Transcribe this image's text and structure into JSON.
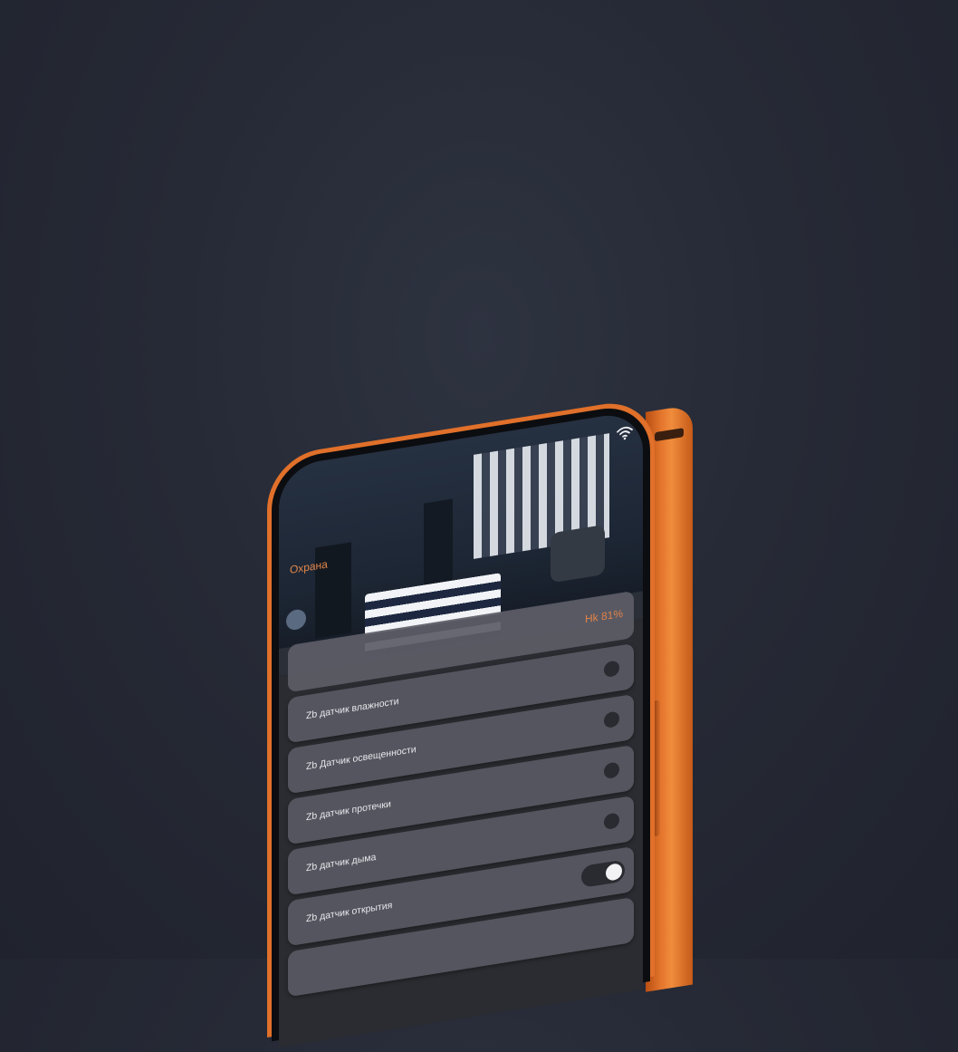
{
  "screen": {
    "title": "Охрана",
    "humidity_value": "Hk 81%"
  },
  "sensors": [
    {
      "label": "Zb датчик влажности",
      "control": "dot"
    },
    {
      "label": "Zb Датчик освещенности",
      "control": "dot"
    },
    {
      "label": "Zb датчик протечки",
      "control": "dot"
    },
    {
      "label": "Zb датчик дыма",
      "control": "dot"
    },
    {
      "label": "Zb датчик открытия",
      "control": "toggle"
    }
  ],
  "icons": {
    "wifi": "wifi-icon"
  },
  "colors": {
    "background": "#262a36",
    "frame": "#e0702a",
    "accent_text": "#e2854a",
    "tile": "#54555e"
  }
}
